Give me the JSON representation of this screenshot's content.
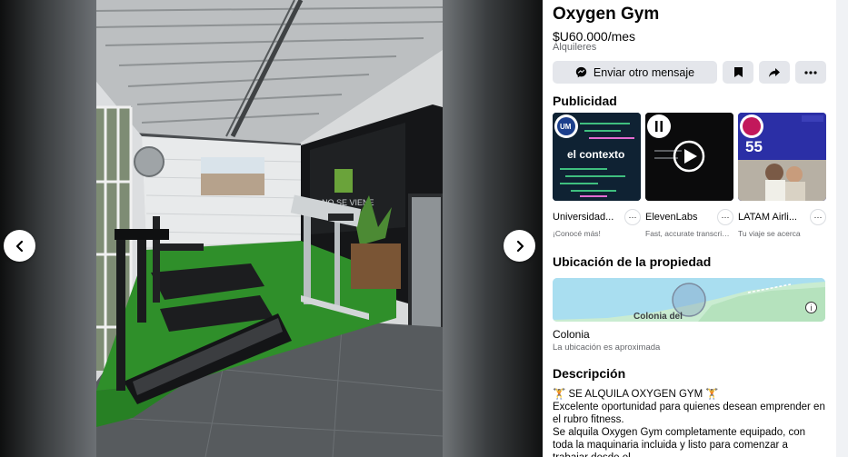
{
  "listing": {
    "title": "Oxygen Gym",
    "price": "$U60.000/mes",
    "category": "Alquileres"
  },
  "actions": {
    "message_label": "Enviar otro mensaje"
  },
  "sections": {
    "ads_heading": "Publicidad",
    "location_heading": "Ubicación de la propiedad",
    "description_heading": "Descripción"
  },
  "ads": [
    {
      "name": "Universidad...",
      "subtitle": "¡Conocé más!",
      "thumb_text": "el contexto",
      "badge": "UM"
    },
    {
      "name": "ElevenLabs",
      "subtitle": "Fast, accurate transcript..."
    },
    {
      "name": "LATAM Airli...",
      "subtitle": "Tu viaje se acerca",
      "thumb_text": "55"
    }
  ],
  "map": {
    "label": "Colonia del"
  },
  "location": {
    "city": "Colonia",
    "note": "La ubicación es aproximada"
  },
  "description": {
    "lines": [
      "🏋 SE ALQUILA OXYGEN GYM 🏋",
      "Excelente oportunidad para quienes desean emprender en el rubro fitness.",
      "Se alquila Oxygen Gym completamente equipado, con toda la maquinaria incluida y listo para comenzar a trabajar desde el"
    ]
  },
  "photo": {
    "wall_text": "NO SE VIENE"
  },
  "colors": {
    "button_bg": "#e4e6eb",
    "text_primary": "#050505",
    "text_secondary": "#65676b",
    "turf_green": "#2f8f2a"
  }
}
